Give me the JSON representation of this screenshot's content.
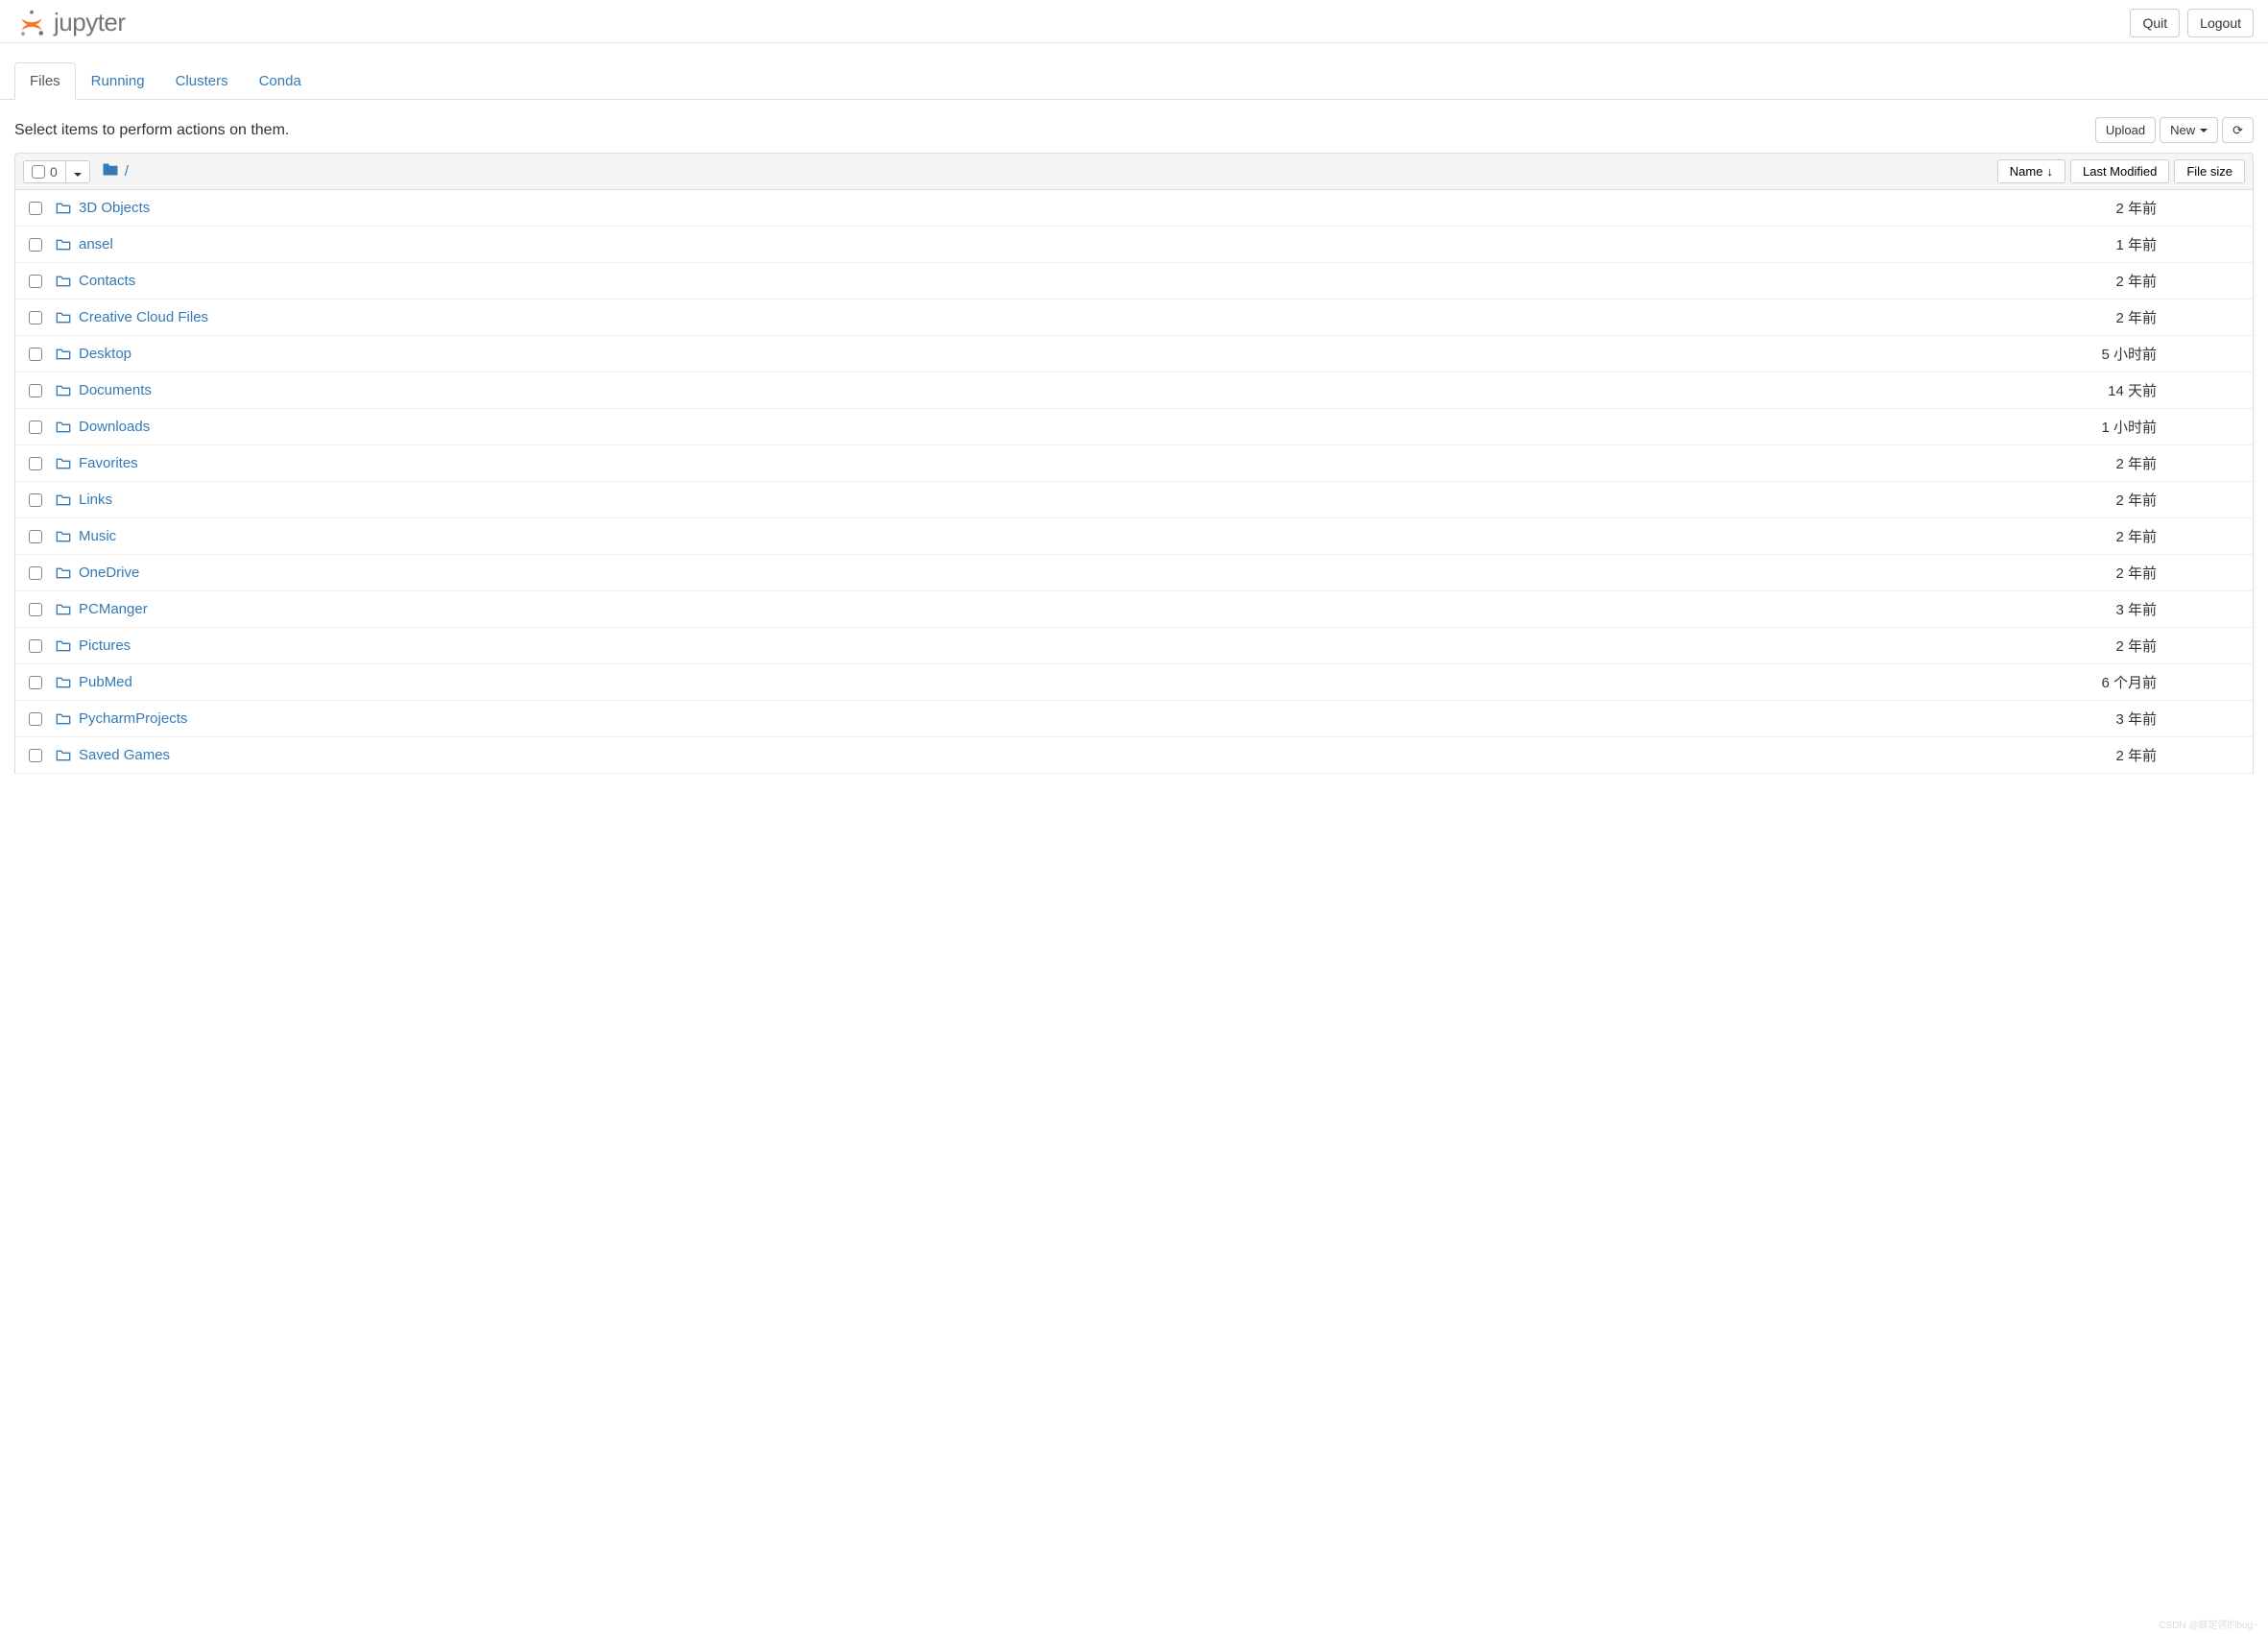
{
  "header": {
    "logo_text": "jupyter",
    "quit_label": "Quit",
    "logout_label": "Logout"
  },
  "tabs": [
    {
      "label": "Files",
      "active": true
    },
    {
      "label": "Running",
      "active": false
    },
    {
      "label": "Clusters",
      "active": false
    },
    {
      "label": "Conda",
      "active": false
    }
  ],
  "toolbar": {
    "prompt": "Select items to perform actions on them.",
    "upload_label": "Upload",
    "new_label": "New"
  },
  "list_header": {
    "selected_count": "0",
    "breadcrumb_root": "/",
    "name_col": "Name",
    "modified_col": "Last Modified",
    "size_col": "File size"
  },
  "items": [
    {
      "name": "3D Objects",
      "modified": "2 年前",
      "size": ""
    },
    {
      "name": "ansel",
      "modified": "1 年前",
      "size": ""
    },
    {
      "name": "Contacts",
      "modified": "2 年前",
      "size": ""
    },
    {
      "name": "Creative Cloud Files",
      "modified": "2 年前",
      "size": ""
    },
    {
      "name": "Desktop",
      "modified": "5 小时前",
      "size": ""
    },
    {
      "name": "Documents",
      "modified": "14 天前",
      "size": ""
    },
    {
      "name": "Downloads",
      "modified": "1 小时前",
      "size": ""
    },
    {
      "name": "Favorites",
      "modified": "2 年前",
      "size": ""
    },
    {
      "name": "Links",
      "modified": "2 年前",
      "size": ""
    },
    {
      "name": "Music",
      "modified": "2 年前",
      "size": ""
    },
    {
      "name": "OneDrive",
      "modified": "2 年前",
      "size": ""
    },
    {
      "name": "PCManger",
      "modified": "3 年前",
      "size": ""
    },
    {
      "name": "Pictures",
      "modified": "2 年前",
      "size": ""
    },
    {
      "name": "PubMed",
      "modified": "6 个月前",
      "size": ""
    },
    {
      "name": "PycharmProjects",
      "modified": "3 年前",
      "size": ""
    },
    {
      "name": "Saved Games",
      "modified": "2 年前",
      "size": ""
    }
  ],
  "watermark": "CSDN @薛定谔的bug~"
}
